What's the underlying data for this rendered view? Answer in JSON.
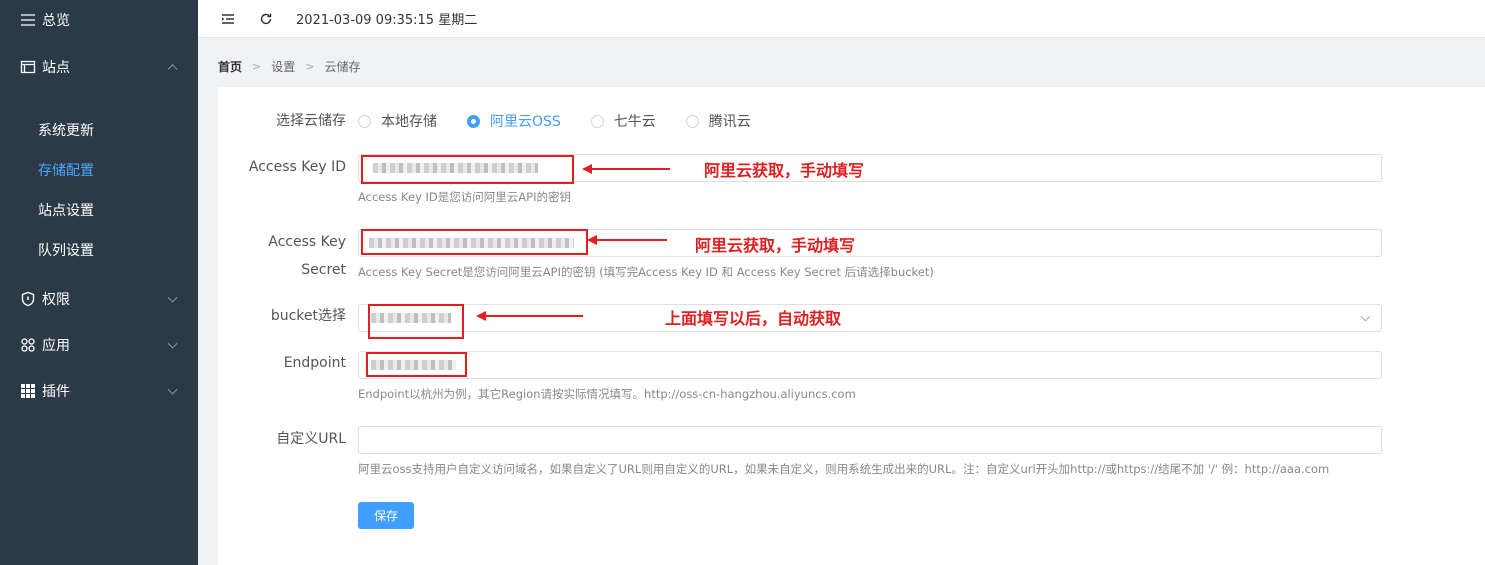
{
  "sidebar": {
    "overview": "总览",
    "site_group": "站点",
    "site_items": [
      {
        "label": "系统更新",
        "active": false
      },
      {
        "label": "存储配置",
        "active": true
      },
      {
        "label": "站点设置",
        "active": false
      },
      {
        "label": "队列设置",
        "active": false
      }
    ],
    "groups": [
      {
        "label": "权限",
        "icon": "shield-icon"
      },
      {
        "label": "应用",
        "icon": "apps-icon"
      },
      {
        "label": "插件",
        "icon": "grid-icon"
      }
    ]
  },
  "header": {
    "datetime": "2021-03-09 09:35:15 星期二"
  },
  "breadcrumb": [
    "首页",
    "设置",
    "云储存"
  ],
  "form": {
    "storage_label": "选择云储存",
    "storage_options": [
      {
        "label": "本地存储",
        "checked": false
      },
      {
        "label": "阿里云OSS",
        "checked": true
      },
      {
        "label": "七牛云",
        "checked": false
      },
      {
        "label": "腾讯云",
        "checked": false
      }
    ],
    "access_key_id_label": "Access Key ID",
    "access_key_id_help": "Access Key ID是您访问阿里云API的密钥",
    "access_key_secret_label_1": "Access Key",
    "access_key_secret_label_2": "Secret",
    "access_key_secret_help": "Access Key Secret是您访问阿里云API的密钥 (填写完Access Key ID 和 Access Key Secret 后请选择bucket)",
    "bucket_label": "bucket选择",
    "endpoint_label": "Endpoint",
    "endpoint_help": "Endpoint以杭州为例，其它Region请按实际情况填写。http://oss-cn-hangzhou.aliyuncs.com",
    "custom_url_label": "自定义URL",
    "custom_url_value": "",
    "custom_url_help": "阿里云oss支持用户自定义访问域名，如果自定义了URL则用自定义的URL，如果未自定义，则用系统生成出来的URL。注：自定义url开头加http://或https://结尾不加 '/' 例：http://aaa.com",
    "save_label": "保存"
  },
  "annotations": {
    "note_1": "阿里云获取，手动填写",
    "note_2": "阿里云获取，手动填写",
    "note_3": "上面填写以后，自动获取"
  },
  "colors": {
    "sidebar_bg": "#2c3a47",
    "accent": "#409eff",
    "annotation": "#e02020"
  }
}
